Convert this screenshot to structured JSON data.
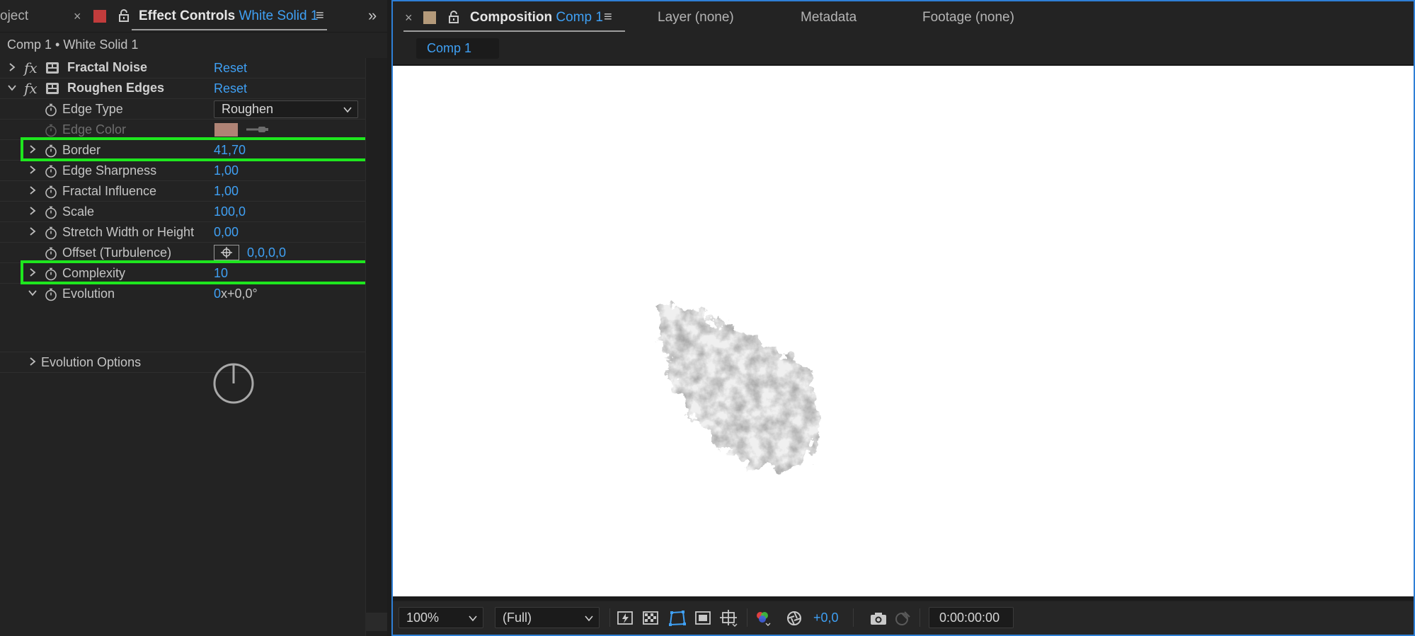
{
  "left_panel": {
    "project_tab": "oject",
    "effect_controls_tab": {
      "title": "Effect Controls",
      "layer": "White Solid 1",
      "menu_glyph": "≡",
      "close_glyph": "×",
      "label_color": "#c23c3c"
    },
    "more_panels_glyph": "»",
    "header_text": "Comp 1 • White Solid 1",
    "effects": [
      {
        "name": "Fractal Noise",
        "reset_label": "Reset",
        "expanded": false
      },
      {
        "name": "Roughen Edges",
        "reset_label": "Reset",
        "expanded": true
      }
    ],
    "params": {
      "edge_type": {
        "label": "Edge Type",
        "value": "Roughen"
      },
      "edge_color": {
        "label": "Edge Color",
        "swatch_color": "#c89484",
        "disabled": true
      },
      "border": {
        "label": "Border",
        "value": "41,70",
        "highlighted": true
      },
      "edge_sharpness": {
        "label": "Edge Sharpness",
        "value": "1,00"
      },
      "fractal_influence": {
        "label": "Fractal Influence",
        "value": "1,00"
      },
      "scale": {
        "label": "Scale",
        "value": "100,0"
      },
      "stretch": {
        "label": "Stretch Width or Height",
        "value": "0,00"
      },
      "offset": {
        "label": "Offset (Turbulence)",
        "value": "0,0,0,0"
      },
      "complexity": {
        "label": "Complexity",
        "value": "10",
        "highlighted": true
      },
      "evolution": {
        "label": "Evolution",
        "value_revs": "0",
        "value_rest": "x+0,0°"
      },
      "evolution_options": {
        "label": "Evolution Options"
      }
    }
  },
  "right_panel": {
    "composition_tab": {
      "title": "Composition",
      "comp_name": "Comp 1",
      "menu_glyph": "≡",
      "close_glyph": "×",
      "label_color": "#b49a7a"
    },
    "layer_tab": "Layer (none)",
    "metadata_tab": "Metadata",
    "footage_tab": "Footage (none)",
    "comp_button": "Comp 1",
    "toolbar": {
      "zoom": "100%",
      "resolution": "(Full)",
      "exposure": "+0,0",
      "timecode": "0:00:00:00"
    }
  },
  "colors": {
    "accent_blue": "#3fa0f4",
    "highlight_green": "#1ee61e",
    "panel_bg": "#232323",
    "active_border": "#2e7fd6"
  }
}
